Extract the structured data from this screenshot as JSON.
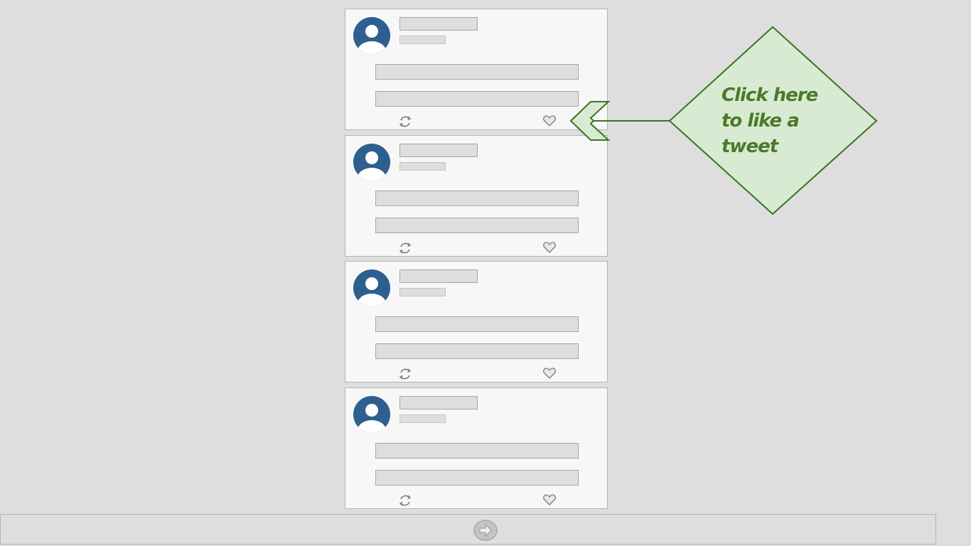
{
  "timeline": {
    "tweets": [
      {
        "retweet_icon": "retweet-icon",
        "like_icon": "heart-icon"
      },
      {
        "retweet_icon": "retweet-icon",
        "like_icon": "heart-icon"
      },
      {
        "retweet_icon": "retweet-icon",
        "like_icon": "heart-icon"
      },
      {
        "retweet_icon": "retweet-icon",
        "like_icon": "heart-icon"
      }
    ]
  },
  "callout": {
    "text": "Click here\nto like a\ntweet",
    "fill_color": "#d9ead3",
    "stroke_color": "#38761d",
    "text_color": "#4a7a2a"
  },
  "footer": {
    "next_icon": "arrow-right-icon"
  },
  "colors": {
    "background": "#dedede",
    "card": "#f7f7f7",
    "avatar": "#2d5f8f"
  }
}
